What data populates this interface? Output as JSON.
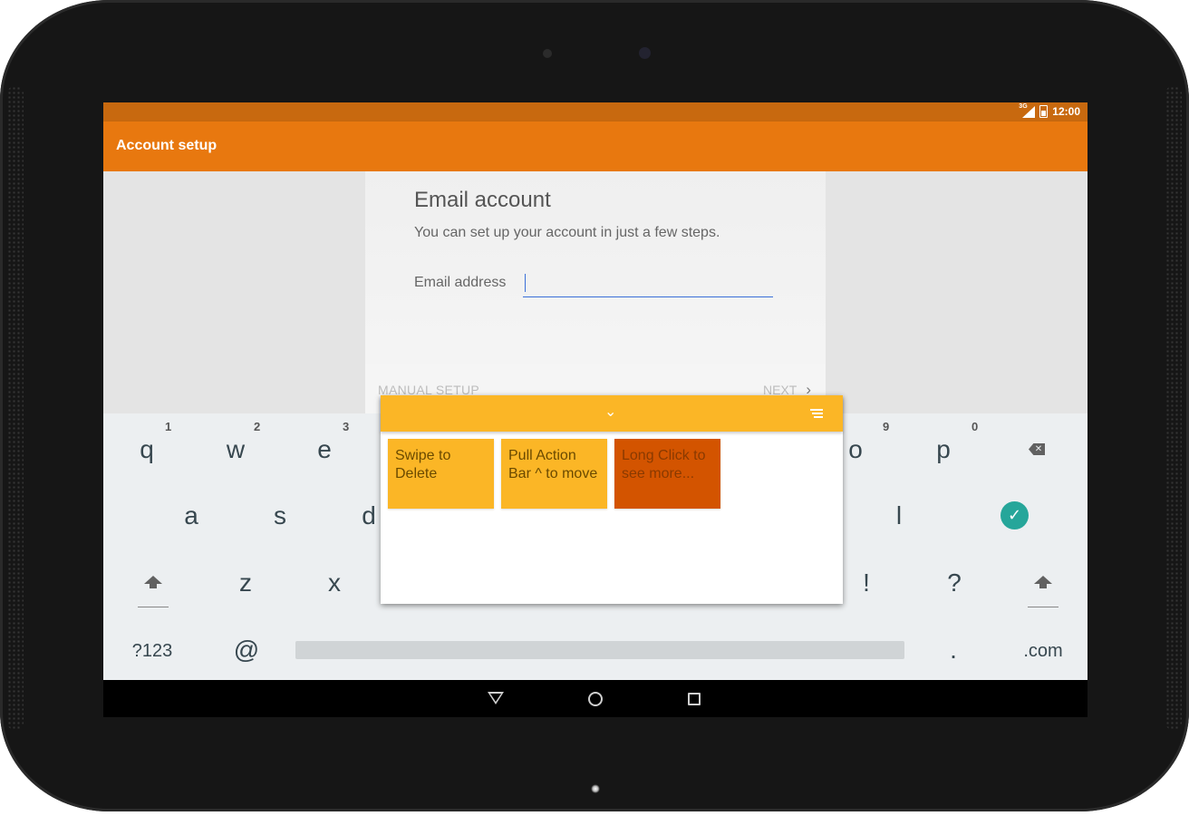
{
  "status_bar": {
    "network": "3G",
    "time": "12:00"
  },
  "app_bar": {
    "title": "Account setup"
  },
  "card": {
    "title": "Email account",
    "subtitle": "You can set up your account in just a few steps.",
    "email_label": "Email address",
    "email_value": "",
    "manual_setup": "MANUAL SETUP",
    "next": "NEXT",
    "next_chevron": "›"
  },
  "keyboard": {
    "row1": [
      {
        "key": "q",
        "hint": "1"
      },
      {
        "key": "w",
        "hint": "2"
      },
      {
        "key": "e",
        "hint": "3"
      },
      {
        "key": "o",
        "hint": "9"
      },
      {
        "key": "p",
        "hint": "0"
      }
    ],
    "row2": [
      "a",
      "s",
      "d",
      "l"
    ],
    "row3": [
      "z",
      "x",
      "!",
      "?"
    ],
    "row4": {
      "symbols": "?123",
      "at": "@",
      "period": ".",
      "dotcom": ".com"
    },
    "enter_glyph": "✓",
    "backspace_glyph": "✕"
  },
  "popup": {
    "chevron": "⌄",
    "notes": [
      {
        "text": "Swipe to Delete",
        "color": "#fbb626"
      },
      {
        "text": "Pull Action Bar ^ to move",
        "color": "#fbb626"
      },
      {
        "text": "Long Click to see more...",
        "color": "#d35400"
      }
    ]
  },
  "colors": {
    "app_bar": "#e8780f",
    "status_bar": "#c8690f",
    "popup_bar": "#fbb626",
    "enter_key": "#26a69a"
  }
}
